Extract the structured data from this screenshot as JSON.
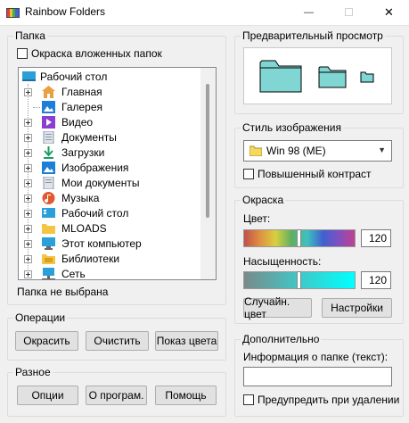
{
  "window": {
    "title": "Rainbow Folders",
    "minimize": "—",
    "maximize": "☐",
    "close": "✕"
  },
  "folder_group": {
    "label": "Папка",
    "colorize_nested": "Окраска вложенных папок",
    "root": "Рабочий стол",
    "items": [
      "Главная",
      "Галерея",
      "Видео",
      "Документы",
      "Загрузки",
      "Изображения",
      "Мои документы",
      "Музыка",
      "Рабочий стол",
      "MLOADS",
      "Этот компьютер",
      "Библиотеки",
      "Сеть"
    ],
    "status": "Папка не выбрана"
  },
  "operations": {
    "label": "Операции",
    "colorize": "Окрасить",
    "clear": "Очистить",
    "show_color": "Показ цвета"
  },
  "misc": {
    "label": "Разное",
    "options": "Опции",
    "about": "О програм.",
    "help": "Помощь"
  },
  "preview": {
    "label": "Предварительный просмотр",
    "folder_color": "#7fd6d2"
  },
  "style": {
    "label": "Стиль изображения",
    "selected": "Win 98 (ME)",
    "high_contrast": "Повышенный контраст"
  },
  "coloring": {
    "label": "Окраска",
    "hue_label": "Цвет:",
    "hue_value": "120",
    "saturation_label": "Насыщенность:",
    "saturation_value": "120",
    "random_color": "Случайн. цвет",
    "settings": "Настройки"
  },
  "additional": {
    "label": "Дополнительно",
    "info_label": "Информация о папке (текст):",
    "info_value": "",
    "warn_on_delete": "Предупредить при удалении"
  }
}
